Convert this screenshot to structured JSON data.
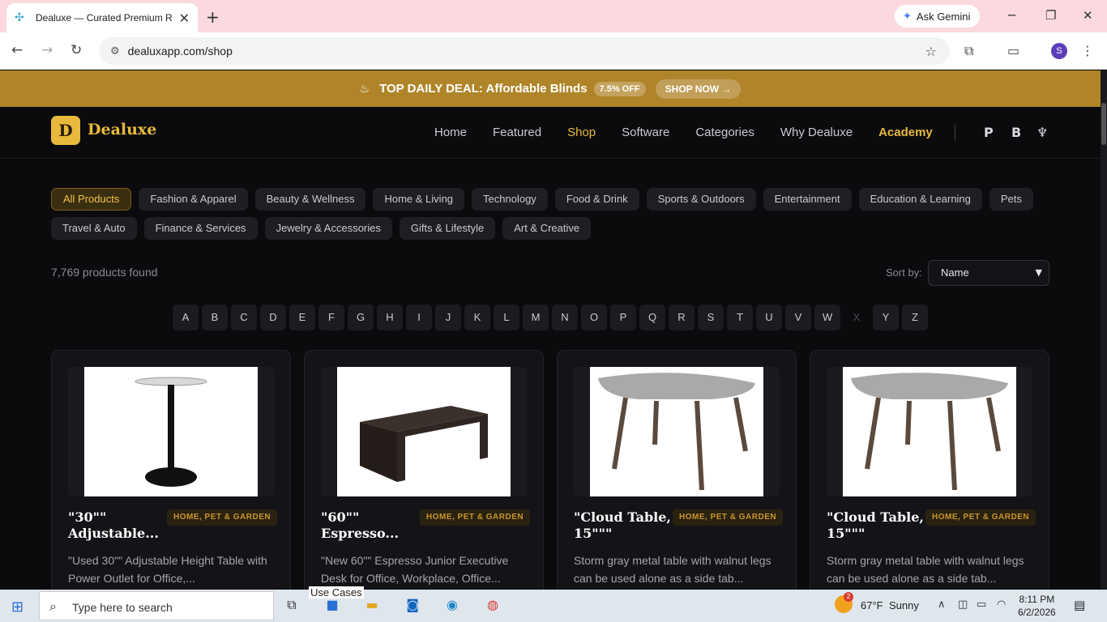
{
  "browser": {
    "tab_title": "Dealuxe — Curated Premium R",
    "new_tab": "+",
    "ask_gemini": "Ask Gemini",
    "url": "dealuxapp.com/shop",
    "profile_initial": "S"
  },
  "promo": {
    "text": "TOP DAILY DEAL: Affordable Blinds",
    "badge": "7.5% OFF",
    "cta": "SHOP NOW →"
  },
  "site": {
    "brand": "Dealuxe",
    "logo_letter": "D",
    "nav": [
      "Home",
      "Featured",
      "Shop",
      "Software",
      "Categories",
      "Why Dealuxe",
      "Academy"
    ],
    "social": [
      "P",
      "B",
      "♆"
    ]
  },
  "categories": {
    "row1": [
      "All Products",
      "Fashion & Apparel",
      "Beauty & Wellness",
      "Home & Living",
      "Technology",
      "Food & Drink",
      "Sports & Outdoors",
      "Entertainment",
      "Education & Learning",
      "Pets"
    ],
    "row2": [
      "Travel & Auto",
      "Finance & Services",
      "Jewelry & Accessories",
      "Gifts & Lifestyle",
      "Art & Creative"
    ]
  },
  "results": {
    "count_text": "7,769 products found",
    "sort_label": "Sort by:",
    "sort_value": "Name"
  },
  "alphabet": [
    "A",
    "B",
    "C",
    "D",
    "E",
    "F",
    "G",
    "H",
    "I",
    "J",
    "K",
    "L",
    "M",
    "N",
    "O",
    "P",
    "Q",
    "R",
    "S",
    "T",
    "U",
    "V",
    "W",
    "X",
    "Y",
    "Z"
  ],
  "products": [
    {
      "name": "\"30\"\" Adjustable...",
      "category": "HOME, PET & GARDEN",
      "description": "\"Used 30\"\" Adjustable Height Table with Power Outlet for Office,..."
    },
    {
      "name": "\"60\"\" Espresso...",
      "category": "HOME, PET & GARDEN",
      "description": "\"New 60\"\" Espresso Junior Executive Desk for Office, Workplace, Office..."
    },
    {
      "name": "\"Cloud Table, 15\"\"\"",
      "category": "HOME, PET & GARDEN",
      "description": "Storm gray metal table with walnut legs can be used alone as a side tab..."
    },
    {
      "name": "\"Cloud Table, 15\"\"\"",
      "category": "HOME, PET & GARDEN",
      "description": "Storm gray metal table with walnut legs can be used alone as a side tab..."
    }
  ],
  "taskbar": {
    "search_placeholder": "Type here to search",
    "use_cases": "Use Cases",
    "temperature": "67°F",
    "weather": "Sunny",
    "weather_badge": "2",
    "time": "8:11 PM",
    "date": "6/2/2026"
  },
  "colors": {
    "accent_gold": "#e8b93c",
    "promo_bg": "#b0852a",
    "page_bg": "#0b0b0e"
  }
}
